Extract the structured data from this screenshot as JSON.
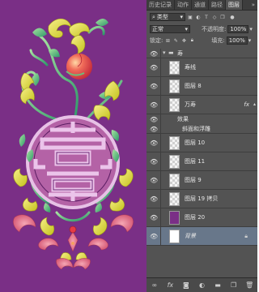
{
  "tabs": [
    "历史记录",
    "动作",
    "通道",
    "路径",
    "图层"
  ],
  "tabs_more": "»",
  "filter": {
    "label": "类型"
  },
  "blend_mode": "正常",
  "opacity": {
    "label": "不透明度:",
    "value": "100%"
  },
  "lock": {
    "label": "锁定:"
  },
  "fill": {
    "label": "填充:",
    "value": "100%"
  },
  "layers": [
    {
      "name": "寿",
      "type": "group"
    },
    {
      "name": "寿线"
    },
    {
      "name": "图层 8"
    },
    {
      "name": "万寿",
      "fx": "fx"
    },
    {
      "name": "效果",
      "type": "effect"
    },
    {
      "name": "斜面和浮雕",
      "type": "effect-item"
    },
    {
      "name": "图层 10"
    },
    {
      "name": "图层 11"
    },
    {
      "name": "图层 9"
    },
    {
      "name": "图层 19 拷贝"
    },
    {
      "name": "图层 20"
    },
    {
      "name": "背景",
      "type": "background"
    }
  ],
  "colors": {
    "canvas": "#7a2f86",
    "panel": "#535353",
    "selected": "#68778a"
  }
}
